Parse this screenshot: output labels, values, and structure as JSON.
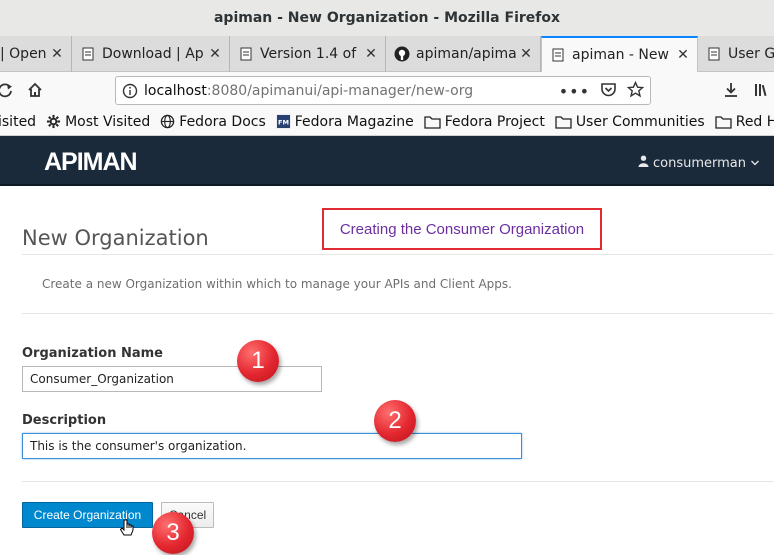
{
  "window": {
    "title": "apiman - New Organization - Mozilla Firefox"
  },
  "tabs": [
    {
      "label": "| Open",
      "icon": "puzzle-icon"
    },
    {
      "label": "Download | Ap",
      "icon": "page-icon"
    },
    {
      "label": "Version 1.4 of",
      "icon": "page-icon"
    },
    {
      "label": "apiman/apiman",
      "icon": "github-icon"
    },
    {
      "label": "apiman - New",
      "icon": "apiman-icon",
      "active": true
    },
    {
      "label": "User Gu",
      "icon": "page-icon"
    }
  ],
  "tab_close_glyph": "✕",
  "urlbar": {
    "host": "localhost",
    "path": ":8080/apimanui/api-manager/new-org"
  },
  "bookmarks": [
    {
      "label": "isited",
      "icon": "none"
    },
    {
      "label": "Most Visited",
      "icon": "gear-icon"
    },
    {
      "label": "Fedora Docs",
      "icon": "globe-icon"
    },
    {
      "label": "Fedora Magazine",
      "icon": "fm-icon"
    },
    {
      "label": "Fedora Project",
      "icon": "folder-icon"
    },
    {
      "label": "User Communities",
      "icon": "folder-icon"
    },
    {
      "label": "Red Hat",
      "icon": "folder-icon"
    }
  ],
  "app": {
    "logo": "APIMAN",
    "user": "consumerman",
    "header_color": "#1b2a3b"
  },
  "page": {
    "title": "New Organization",
    "description": "Create a new Organization within which to manage your APIs and Client Apps.",
    "name_label": "Organization Name",
    "name_value": "Consumer_Organization",
    "description_label": "Description",
    "description_value": "This is the consumer's organization.",
    "create_button": "Create Organization",
    "cancel_button": "Cancel"
  },
  "annotations": {
    "callout": "Creating the Consumer Organization",
    "step1": "1",
    "step2": "2",
    "step3": "3",
    "accent": "#e02b35"
  }
}
